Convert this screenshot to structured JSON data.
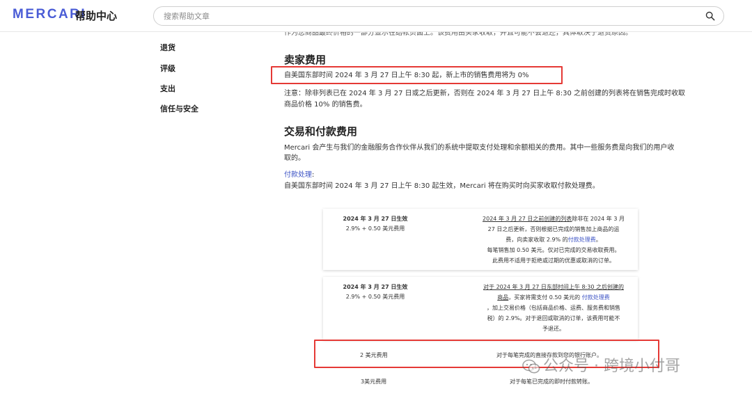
{
  "header": {
    "logo": "MERCARI",
    "title": "帮助中心",
    "search_placeholder": "搜索帮助文章"
  },
  "sidebar": {
    "items": [
      "退货",
      "评级",
      "支出",
      "信任与安全"
    ]
  },
  "content": {
    "top_cut_text": "作为您商品最终价格的一部分显示在结帐页面上。该费用由买家收取，并且可能不会退还，具体取决于退货原因。",
    "seller_fees": {
      "heading": "卖家费用",
      "line1": "自美国东部时间 2024 年 3 月 27 日上午 8:30 起，新上市的销售费用将为 0%",
      "note_line1": "注意：除非列表已在 2024 年 3 月 27 日或之后更新，否则在 2024 年 3 月 27 日上午 8:30 之前创建的列表将在销售完成时收取",
      "note_line2": "商品价格 10% 的销售费。"
    },
    "transaction_fees": {
      "heading": "交易和付款费用",
      "para_line1": "Mercari 会产生与我们的金融服务合作伙伴从我们的系统中提取支付处理和余额相关的费用。其中一些服务费是向我们的用户收",
      "para_line2": "取的。",
      "payment_link": "付款处理",
      "payment_colon": ":",
      "payment_line": "自美国东部时间 2024 年 3 月 27 日上午 8:30 起生效，Mercari 将在购买时向买家收取付款处理费。"
    },
    "table1": {
      "left_title": "2024 年 3 月 27 日生效",
      "left_value": "2.9% + 0.50 美元费用",
      "right_l1_u": "2024 年 3 月 27 日之前创建的列表",
      "right_l1_rest": "除非在 2024 年 3 月",
      "right_l2": "27 日之后更新，否则根据已完成的销售加上商品的运",
      "right_l3_pre": "费，向卖家收取 2.9% 的",
      "right_l3_link": "付款处理费",
      "right_l3_post": "。",
      "right_l4": "每笔销售加 0.50 美元。仅对已完成的交易收取费用。",
      "right_l5": "此费用不适用于拒绝或过期的优惠或取消的订单。"
    },
    "table2": {
      "left_title": "2024 年 3 月 27 日生效",
      "left_value": "2.9% + 0.50 美元费用",
      "right_l1_u": "对于 2024 年 3 月 27 日东部时间上午 8:30 之后创建的",
      "right_l2_u": "商品",
      "right_l2_rest": "，买家将需支付 0.50 美元的",
      "right_l2_link": "付款处理费",
      "right_l3": "，加上交易价格（包括商品价格、运费、服务费和销售",
      "right_l4": "税）的 2.9%。对于退回或取消的订单，该费用可能不",
      "right_l5": "予退还。"
    },
    "row3": {
      "left": "2 美元费用",
      "right": "对于每笔完成的直接存款到您的银行账户。"
    },
    "row4": {
      "left": "3美元费用",
      "right": "对于每笔已完成的即时付款转账。"
    }
  },
  "watermark": {
    "text": "公众号 · 跨境小付哥"
  },
  "colors": {
    "brand": "#4a5cd6",
    "link": "#3b52c4",
    "highlight": "#e53935"
  }
}
